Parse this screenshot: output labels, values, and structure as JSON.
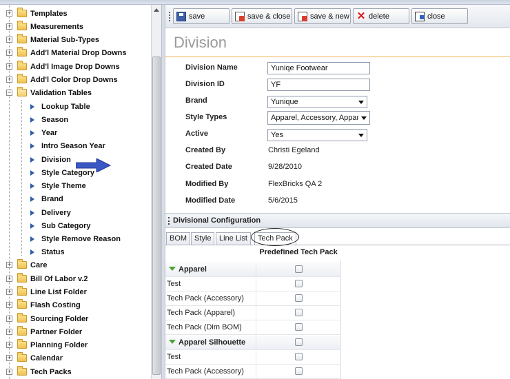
{
  "tree": {
    "folders_top": [
      "Templates",
      "Measurements",
      "Material Sub-Types",
      "Add'l Material Drop Downs",
      "Add'l Image Drop Downs",
      "Add'l Color Drop Downs"
    ],
    "open_folder": "Validation Tables",
    "children": [
      "Lookup Table",
      "Season",
      "Year",
      "Intro Season Year",
      "Division",
      "Style Category",
      "Style Theme",
      "Brand",
      "Delivery",
      "Sub Category",
      "Style Remove Reason",
      "Status"
    ],
    "folders_bottom": [
      "Care",
      "Bill Of Labor v.2",
      "Line List Folder",
      "Flash Costing",
      "Sourcing Folder",
      "Partner Folder",
      "Planning Folder",
      "Calendar",
      "Tech Packs"
    ],
    "expander_collapsed": "+",
    "expander_expanded": "−"
  },
  "toolbar": {
    "save": "save",
    "save_close": "save & close",
    "save_new": "save & new",
    "delete": "delete",
    "close": "close"
  },
  "page_title": "Division",
  "form": {
    "division_name_label": "Division Name",
    "division_name_value": "Yuniqe Footwear",
    "division_id_label": "Division ID",
    "division_id_value": "YF",
    "brand_label": "Brand",
    "brand_value": "Yunique",
    "style_types_label": "Style Types",
    "style_types_value": "Apparel, Accessory, Appar",
    "active_label": "Active",
    "active_value": "Yes",
    "created_by_label": "Created By",
    "created_by_value": "Christi Egeland",
    "created_date_label": "Created Date",
    "created_date_value": "9/28/2010",
    "modified_by_label": "Modified By",
    "modified_by_value": "FlexBricks QA 2",
    "modified_date_label": "Modified Date",
    "modified_date_value": "5/6/2015"
  },
  "section": {
    "title": "Divisional Configuration"
  },
  "tabs": [
    "BOM",
    "Style",
    "Line List",
    "Tech Pack"
  ],
  "active_tab": "Tech Pack",
  "grid": {
    "column_header": "Predefined Tech Pack",
    "groups": [
      {
        "name": "Apparel",
        "rows": [
          "Test",
          "Tech Pack (Accessory)",
          "Tech Pack (Apparel)",
          "Tech Pack (Dim BOM)"
        ]
      },
      {
        "name": "Apparel Silhouette",
        "rows": [
          "Test",
          "Tech Pack (Accessory)"
        ]
      }
    ]
  },
  "colors": {
    "accent_arrow": "#3b57c4",
    "title_underline": "#f0b35a",
    "group_triangle": "#4ba32c"
  }
}
